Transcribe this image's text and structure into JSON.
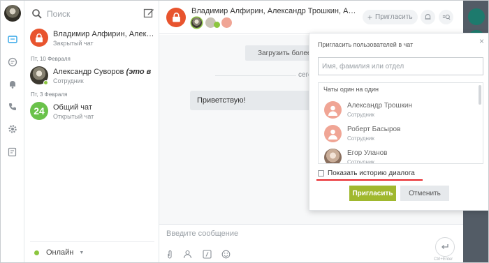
{
  "search": {
    "placeholder": "Поиск"
  },
  "contacts": {
    "items": [
      {
        "name": "Владимир Алфирин, Александр Трошкин",
        "sub": "Закрытый чат",
        "avatar_color": "#e8542e"
      },
      {
        "date": "Пт, 10 Февраля",
        "name": "Александр Суворов",
        "name_suffix": "(это в",
        "sub": "Сотрудник"
      },
      {
        "date": "Пт, 3 Февраля",
        "name": "Общий чат",
        "sub": "Открытый чат",
        "badge": "24",
        "avatar_color": "#6ac24a"
      }
    ],
    "status": "Онлайн"
  },
  "chat": {
    "title": "Владимир Алфирин, Александр Трошкин, Алекса...",
    "invite_label": "Пригласить",
    "load_more": "Загрузить более р",
    "day_label": "сего",
    "message": "Приветствую!",
    "input_placeholder": "Введите сообщение",
    "send_hint": "Ctrl+Enter"
  },
  "popup": {
    "title": "Пригласить пользователей в чат",
    "input_placeholder": "Имя, фамилия или отдел",
    "list_title": "Чаты один на один",
    "people": [
      {
        "name": "Александр Трошкин",
        "role": "Сотрудник"
      },
      {
        "name": "Роберт Басыров",
        "role": "Сотрудник"
      },
      {
        "name": "Егор Уланов",
        "role": "Сотрудник"
      }
    ],
    "history_label": "Показать историю диалога",
    "invite_button": "Пригласить",
    "cancel_button": "Отменить",
    "close": "×"
  },
  "colors": {
    "accent_green": "#a0b82e",
    "online": "#8cc63f",
    "closed_chat": "#e8542e",
    "highlight_line": "#e8262a"
  }
}
